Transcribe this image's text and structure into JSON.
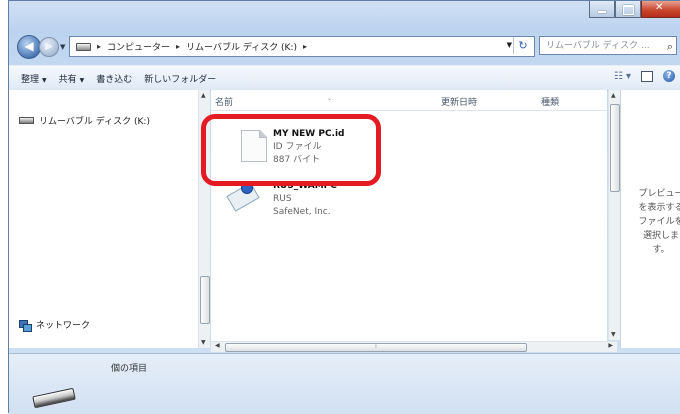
{
  "navigation": {
    "back_glyph": "◀",
    "forward_glyph": "▶",
    "address_segments": [
      "コンピューター",
      "リムーバブル ディスク (K:)"
    ],
    "search_placeholder": "リムーバブル ディスク ..."
  },
  "toolbar": {
    "organize": "整理",
    "share": "共有",
    "burn": "書き込む",
    "new_folder": "新しいフォルダー"
  },
  "nav_pane": {
    "drive": "リムーバブル ディスク (K:)",
    "network": "ネットワーク"
  },
  "columns": {
    "name": "名前",
    "modified": "更新日時",
    "type": "種類"
  },
  "files": [
    {
      "name": "MY NEW PC.id",
      "type": "ID ファイル",
      "size": "887 バイト",
      "icon": "document-icon"
    },
    {
      "name": "RUS_WAMPC",
      "publisher_line1": "RUS",
      "publisher_line2": "SafeNet, Inc.",
      "icon": "certificate-icon"
    }
  ],
  "preview": {
    "message": "プレビュー\nを表示する\nファイルを\n選択しま\nす。"
  },
  "details": {
    "item_count": "個の項目"
  },
  "colors": {
    "highlight": "#e41b23",
    "window_frame": "#bcd3ef"
  }
}
